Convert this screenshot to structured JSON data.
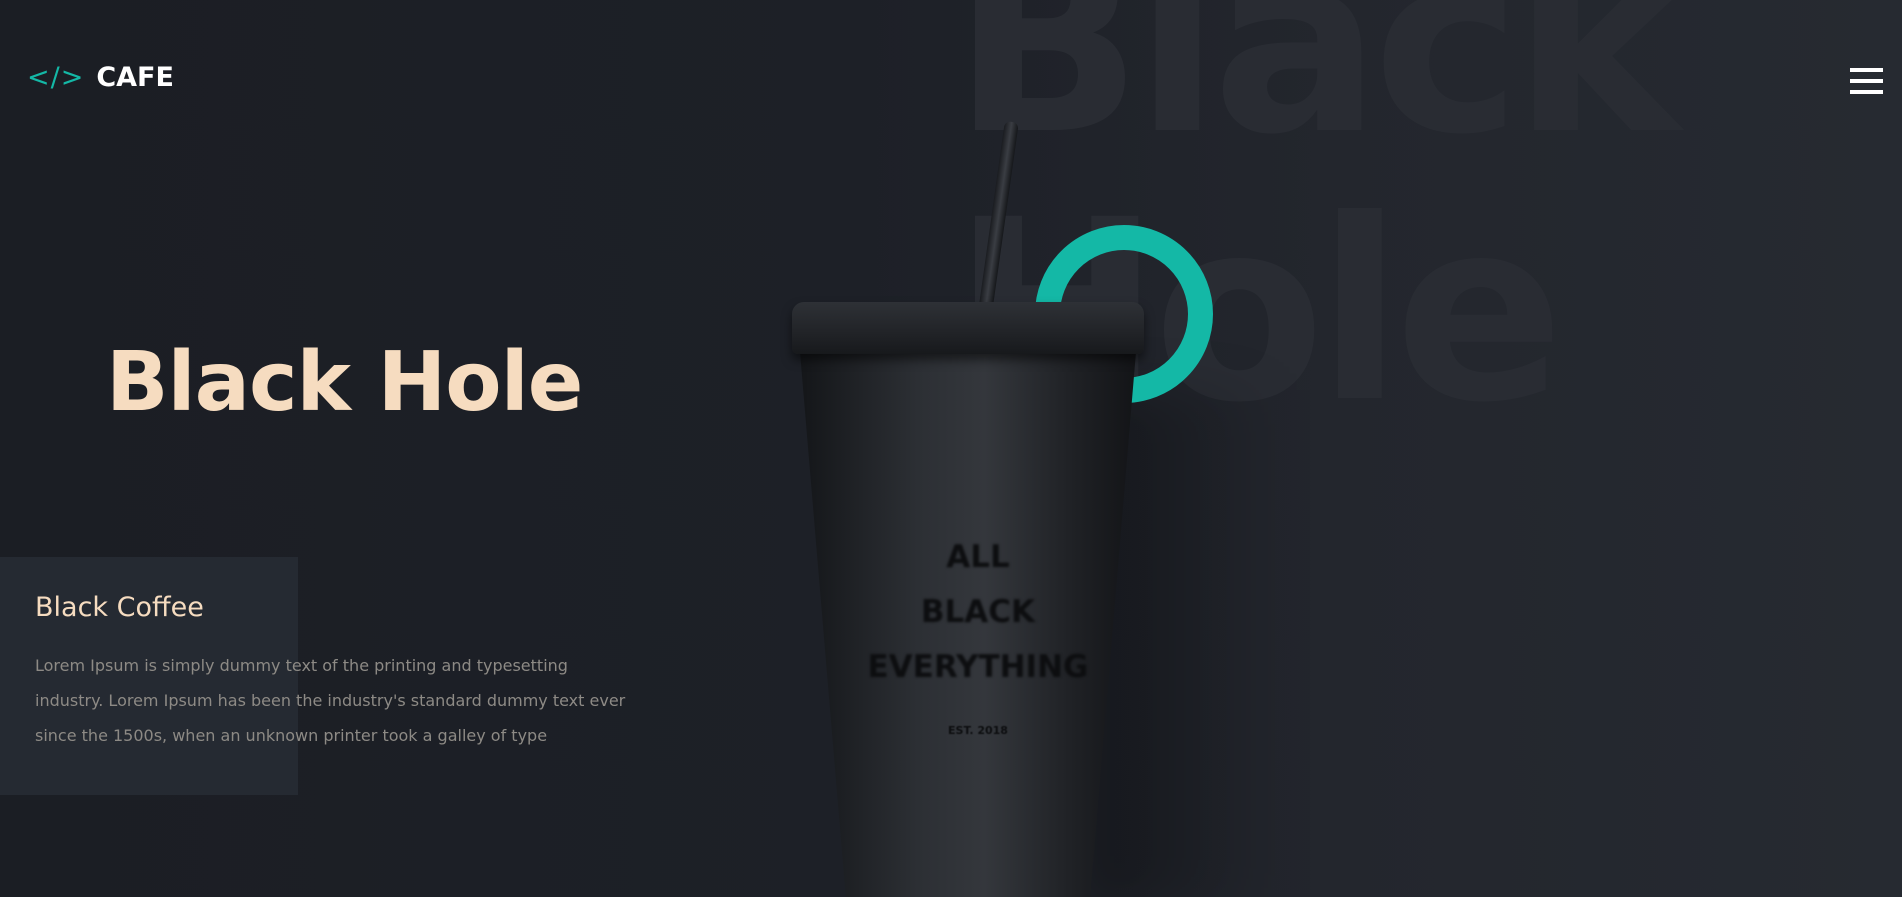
{
  "header": {
    "logo_icon": "</>",
    "logo_text": "CAFE",
    "menu_icon": "hamburger-menu-icon"
  },
  "background": {
    "watermark_line1": "Black",
    "watermark_line2": "Hole"
  },
  "hero": {
    "title": "Black Hole"
  },
  "product": {
    "cup_print": "ALL\nBLACK\nEVERYTHING",
    "cup_est": "EST. 2018"
  },
  "info": {
    "title": "Black Coffee",
    "description": "Lorem Ipsum is simply dummy text of the printing and typesetting industry. Lorem Ipsum has been the industry's standard dummy text ever since the 1500s, when an unknown printer took a galley of type"
  },
  "colors": {
    "accent": "#14b8a6",
    "title": "#f6dcc0",
    "background": "#1c1f25",
    "panel": "#252a32",
    "body_text": "#8d8a85"
  }
}
